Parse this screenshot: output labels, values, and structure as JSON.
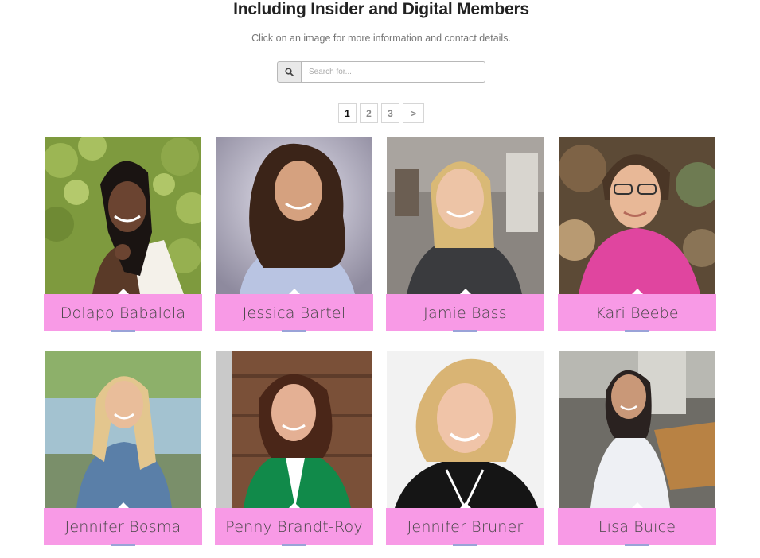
{
  "header": {
    "title": "Including Insider and Digital Members",
    "subtitle": "Click on an image for more information and contact details."
  },
  "search": {
    "placeholder": "Search for...",
    "icon": "search-icon"
  },
  "pagination": {
    "pages": [
      "1",
      "2",
      "3"
    ],
    "current": "1",
    "next_label": ">"
  },
  "colors": {
    "label_bg": "#f89ae6",
    "underline": "#9aa3d8"
  },
  "members": [
    {
      "name": "Dolapo Babalola"
    },
    {
      "name": "Jessica Bartel"
    },
    {
      "name": "Jamie Bass"
    },
    {
      "name": "Kari Beebe"
    },
    {
      "name": "Jennifer Bosma"
    },
    {
      "name": "Penny Brandt-Roy"
    },
    {
      "name": "Jennifer Bruner"
    },
    {
      "name": "Lisa Buice"
    }
  ]
}
